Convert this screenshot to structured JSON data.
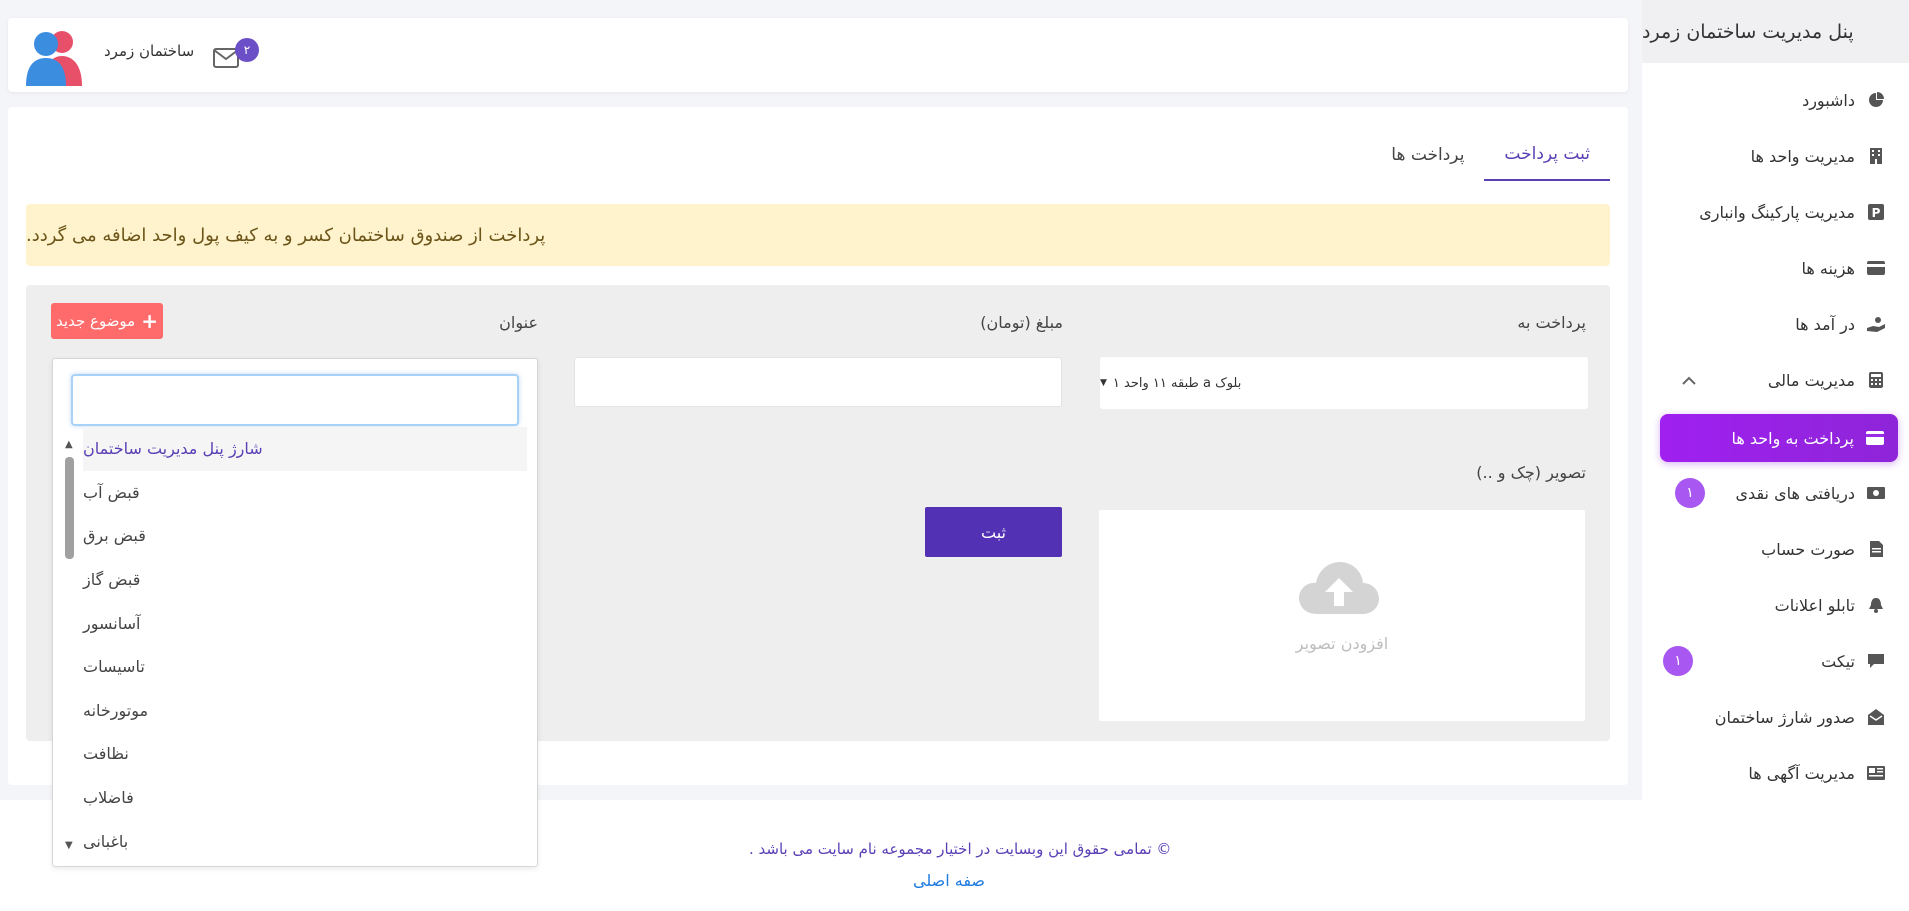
{
  "sidebar": {
    "title": "پنل مدیریت ساختمان زمرد",
    "items": [
      {
        "label": "داشبورد",
        "icon": "chart-pie-icon"
      },
      {
        "label": "مدیریت واحد ها",
        "icon": "building-icon"
      },
      {
        "label": "مدیریت پارکینگ وانباری",
        "icon": "parking-icon"
      },
      {
        "label": "هزینه ها",
        "icon": "credit-card-icon"
      },
      {
        "label": "در آمد ها",
        "icon": "hand-money-icon"
      },
      {
        "label": "مدیریت مالی",
        "icon": "calculator-icon"
      },
      {
        "label": "پرداخت به واحد ها",
        "icon": "card-icon"
      },
      {
        "label": "دریافتی های نقدی",
        "icon": "cash-icon",
        "badge": "۱"
      },
      {
        "label": "صورت حساب",
        "icon": "file-icon"
      },
      {
        "label": "تابلو اعلانات",
        "icon": "bell-icon"
      },
      {
        "label": "تیکت",
        "icon": "comment-icon",
        "badge": "۱"
      },
      {
        "label": "صدور شارژ ساختمان",
        "icon": "mail-open-icon"
      },
      {
        "label": "مدیریت آگهی ها",
        "icon": "newspaper-icon"
      }
    ]
  },
  "topbar": {
    "user_name": "ساختمان زمرد",
    "mail_count": "۲"
  },
  "tabs": [
    {
      "label": "ثبت پرداخت",
      "active": true
    },
    {
      "label": "پرداخت ها",
      "active": false
    }
  ],
  "alert": "پرداخت از صندوق ساختمان کسر و به کیف پول واحد اضافه می گردد.",
  "form": {
    "pay_to_label": "پرداخت به",
    "pay_to_value": "بلوک a طبقه ۱۱ واحد ۱",
    "amount_label": "مبلغ (تومان)",
    "amount_value": "",
    "title_label": "عنوان",
    "new_topic_label": "موضوع جدید",
    "image_label": "تصویر (چک و ..)",
    "upload_text": "افزودن تصویر",
    "submit_label": "ثبت"
  },
  "dropdown": {
    "search_value": "",
    "options": [
      "شارژ پنل مدیریت ساختمان",
      "قبض آب",
      "قبض برق",
      "قبض گاز",
      "آسانسور",
      "تاسیسات",
      "موتورخانه",
      "نظافت",
      "فاضلاب",
      "باغبانی"
    ],
    "selected": "شارژ پنل مدیریت ساختمان"
  },
  "footer": {
    "copyright": "© تمامی حقوق این وبسایت در اختیار مجموعه نام سایت می باشد .",
    "home_link": "صفه اصلی"
  },
  "colors": {
    "accent": "#5a3fb5",
    "active_menu": "#a020f0",
    "alert_bg": "#fff3cd",
    "new_topic_bg": "#ff6b6b",
    "submit_bg": "#5231b4"
  }
}
